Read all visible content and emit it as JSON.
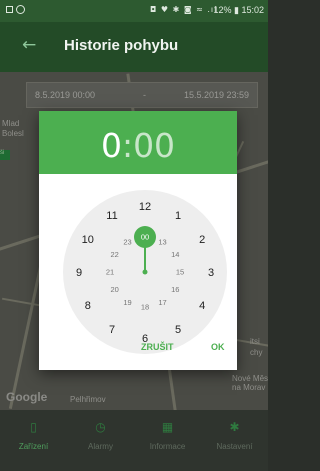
{
  "status_bar": {
    "icons": "◘ ♥ ✱ ◙ ≈ .ıl",
    "text": "12% ▮ 15:02"
  },
  "app_bar": {
    "back_icon": "arrow-left-icon",
    "title": "Historie pohybu"
  },
  "date_range": {
    "from": "8.5.2019 00:00",
    "separator": "-",
    "to": "15.5.2019 23:59"
  },
  "map": {
    "labels": [
      "Mlad",
      "Bolesl",
      "Pelhřimov",
      "Nové Měs",
      "na Morav",
      "itsi",
      "chy"
    ],
    "provider": "Google"
  },
  "dialog": {
    "time_hours": "0",
    "time_colon": ":",
    "time_minutes": "00",
    "outer_hours": [
      "12",
      "1",
      "2",
      "3",
      "4",
      "5",
      "6",
      "7",
      "8",
      "9",
      "10",
      "11"
    ],
    "inner_hours": [
      "00",
      "13",
      "14",
      "15",
      "16",
      "17",
      "18",
      "19",
      "20",
      "21",
      "22",
      "23"
    ],
    "selected": "00",
    "cancel_label": "ZRUŠIT",
    "ok_label": "OK"
  },
  "bottom_nav": [
    {
      "label": "Zařízení",
      "icon": "device-icon"
    },
    {
      "label": "Alarmy",
      "icon": "alarm-clock-icon"
    },
    {
      "label": "Informace",
      "icon": "calendar-icon"
    },
    {
      "label": "Nastavení",
      "icon": "gear-icon"
    }
  ],
  "colors": {
    "accent": "#4caf50",
    "header_text_dim": "#c8e6c9",
    "clock_face": "#eeeeee"
  }
}
